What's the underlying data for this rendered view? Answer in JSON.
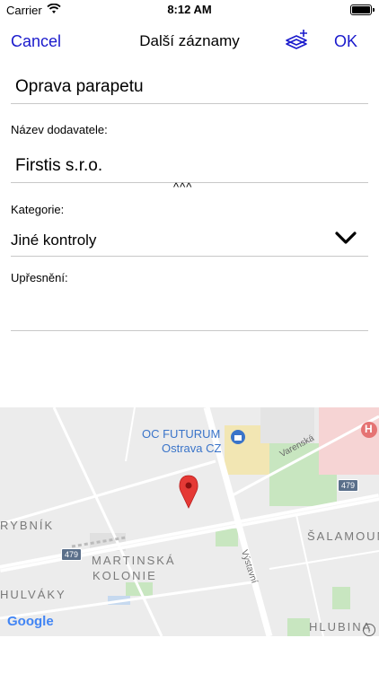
{
  "status_bar": {
    "carrier": "Carrier",
    "time": "8:12 AM"
  },
  "nav": {
    "cancel_label": "Cancel",
    "title": "Další záznamy",
    "ok_label": "OK",
    "layers_icon": "layers-add-icon"
  },
  "form": {
    "field1": {
      "value": "Oprava parapetu"
    },
    "field2": {
      "label": "Název dodavatele:",
      "value": "Firstis s.r.o."
    },
    "expand_label": "^^^",
    "field3": {
      "label": "Kategorie:",
      "value": "Jiné kontroly"
    },
    "field4": {
      "label": "Upřesnění:",
      "value": ""
    }
  },
  "map": {
    "poi_name": "OC FUTURUM",
    "poi_city": "Ostrava CZ",
    "district_1": "MARTINSKÁ",
    "district_2": "KOLONIE",
    "district_3": "HULVÁKY",
    "district_4": "ŠALAMOUN",
    "district_5": "HLUBINA",
    "district_6": "RYBNÍK",
    "street_1": "Varenská",
    "street_2": "Výstavní",
    "road_shield_1": "479",
    "road_shield_2": "479",
    "hospital_label": "H",
    "attribution": "Google",
    "info_label": "i",
    "colors": {
      "road_major": "#ffffff",
      "park": "#c8e6c0",
      "mall": "#f2e6b3",
      "hospital": "#f6d4d4",
      "pin": "#e53935"
    }
  }
}
